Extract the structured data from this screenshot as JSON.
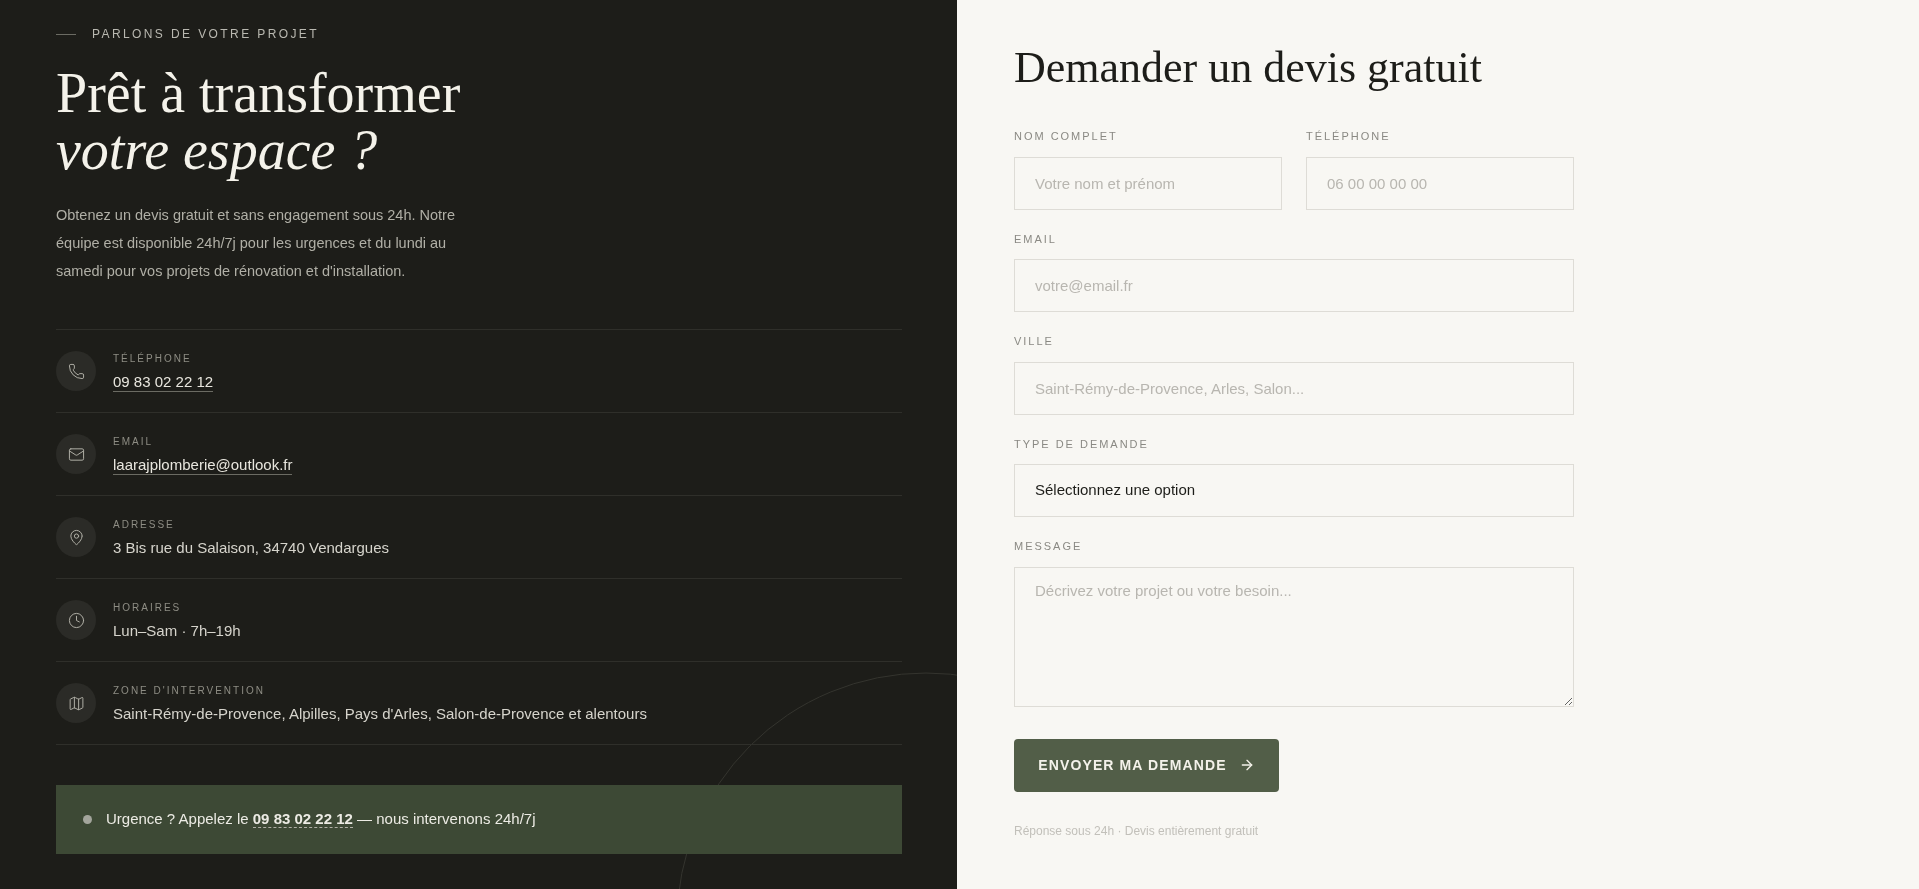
{
  "intro": {
    "eyebrow": "PARLONS DE VOTRE PROJET",
    "title_line1": "Prêt à transformer",
    "title_line2": "votre espace ?",
    "description": "Obtenez un devis gratuit et sans engagement sous 24h. Notre équipe est disponible 24h/7j pour les urgences et du lundi au samedi pour vos projets de rénovation et d'installation."
  },
  "contacts": [
    {
      "kind": "phone",
      "label": "TÉLÉPHONE",
      "value": "09 83 02 22 12",
      "link": true
    },
    {
      "kind": "email",
      "label": "EMAIL",
      "value": "laarajplomberie@outlook.fr",
      "link": true
    },
    {
      "kind": "address",
      "label": "ADRESSE",
      "value": "3 Bis rue du Salaison, 34740 Vendargues",
      "link": false
    },
    {
      "kind": "hours",
      "label": "HORAIRES",
      "value": "Lun–Sam · 7h–19h",
      "link": false
    },
    {
      "kind": "zone",
      "label": "ZONE D'INTERVENTION",
      "value": "Saint-Rémy-de-Provence, Alpilles, Pays d'Arles, Salon-de-Provence et alentours",
      "link": false
    }
  ],
  "urgency": {
    "before": "Urgence ? Appelez le",
    "link": "09 83 02 22 12",
    "after": "— nous intervenons 24h/7j"
  },
  "form": {
    "title": "Demander un devis gratuit",
    "fields": [
      {
        "kind": "input",
        "label": "NOM COMPLET",
        "placeholder": "Votre nom et prénom"
      },
      {
        "kind": "input",
        "label": "TÉLÉPHONE",
        "placeholder": "06 00 00 00 00"
      },
      {
        "kind": "input",
        "label": "EMAIL",
        "placeholder": "votre@email.fr"
      },
      {
        "kind": "input",
        "label": "VILLE",
        "placeholder": "Saint-Rémy-de-Provence, Arles, Salon..."
      },
      {
        "kind": "select",
        "label": "TYPE DE DEMANDE",
        "value": "Sélectionnez une option"
      },
      {
        "kind": "textarea",
        "label": "MESSAGE",
        "placeholder": "Décrivez votre projet ou votre besoin..."
      }
    ],
    "submit": "ENVOYER MA DEMANDE",
    "note": "Réponse sous 24h · Devis entièrement gratuit"
  }
}
